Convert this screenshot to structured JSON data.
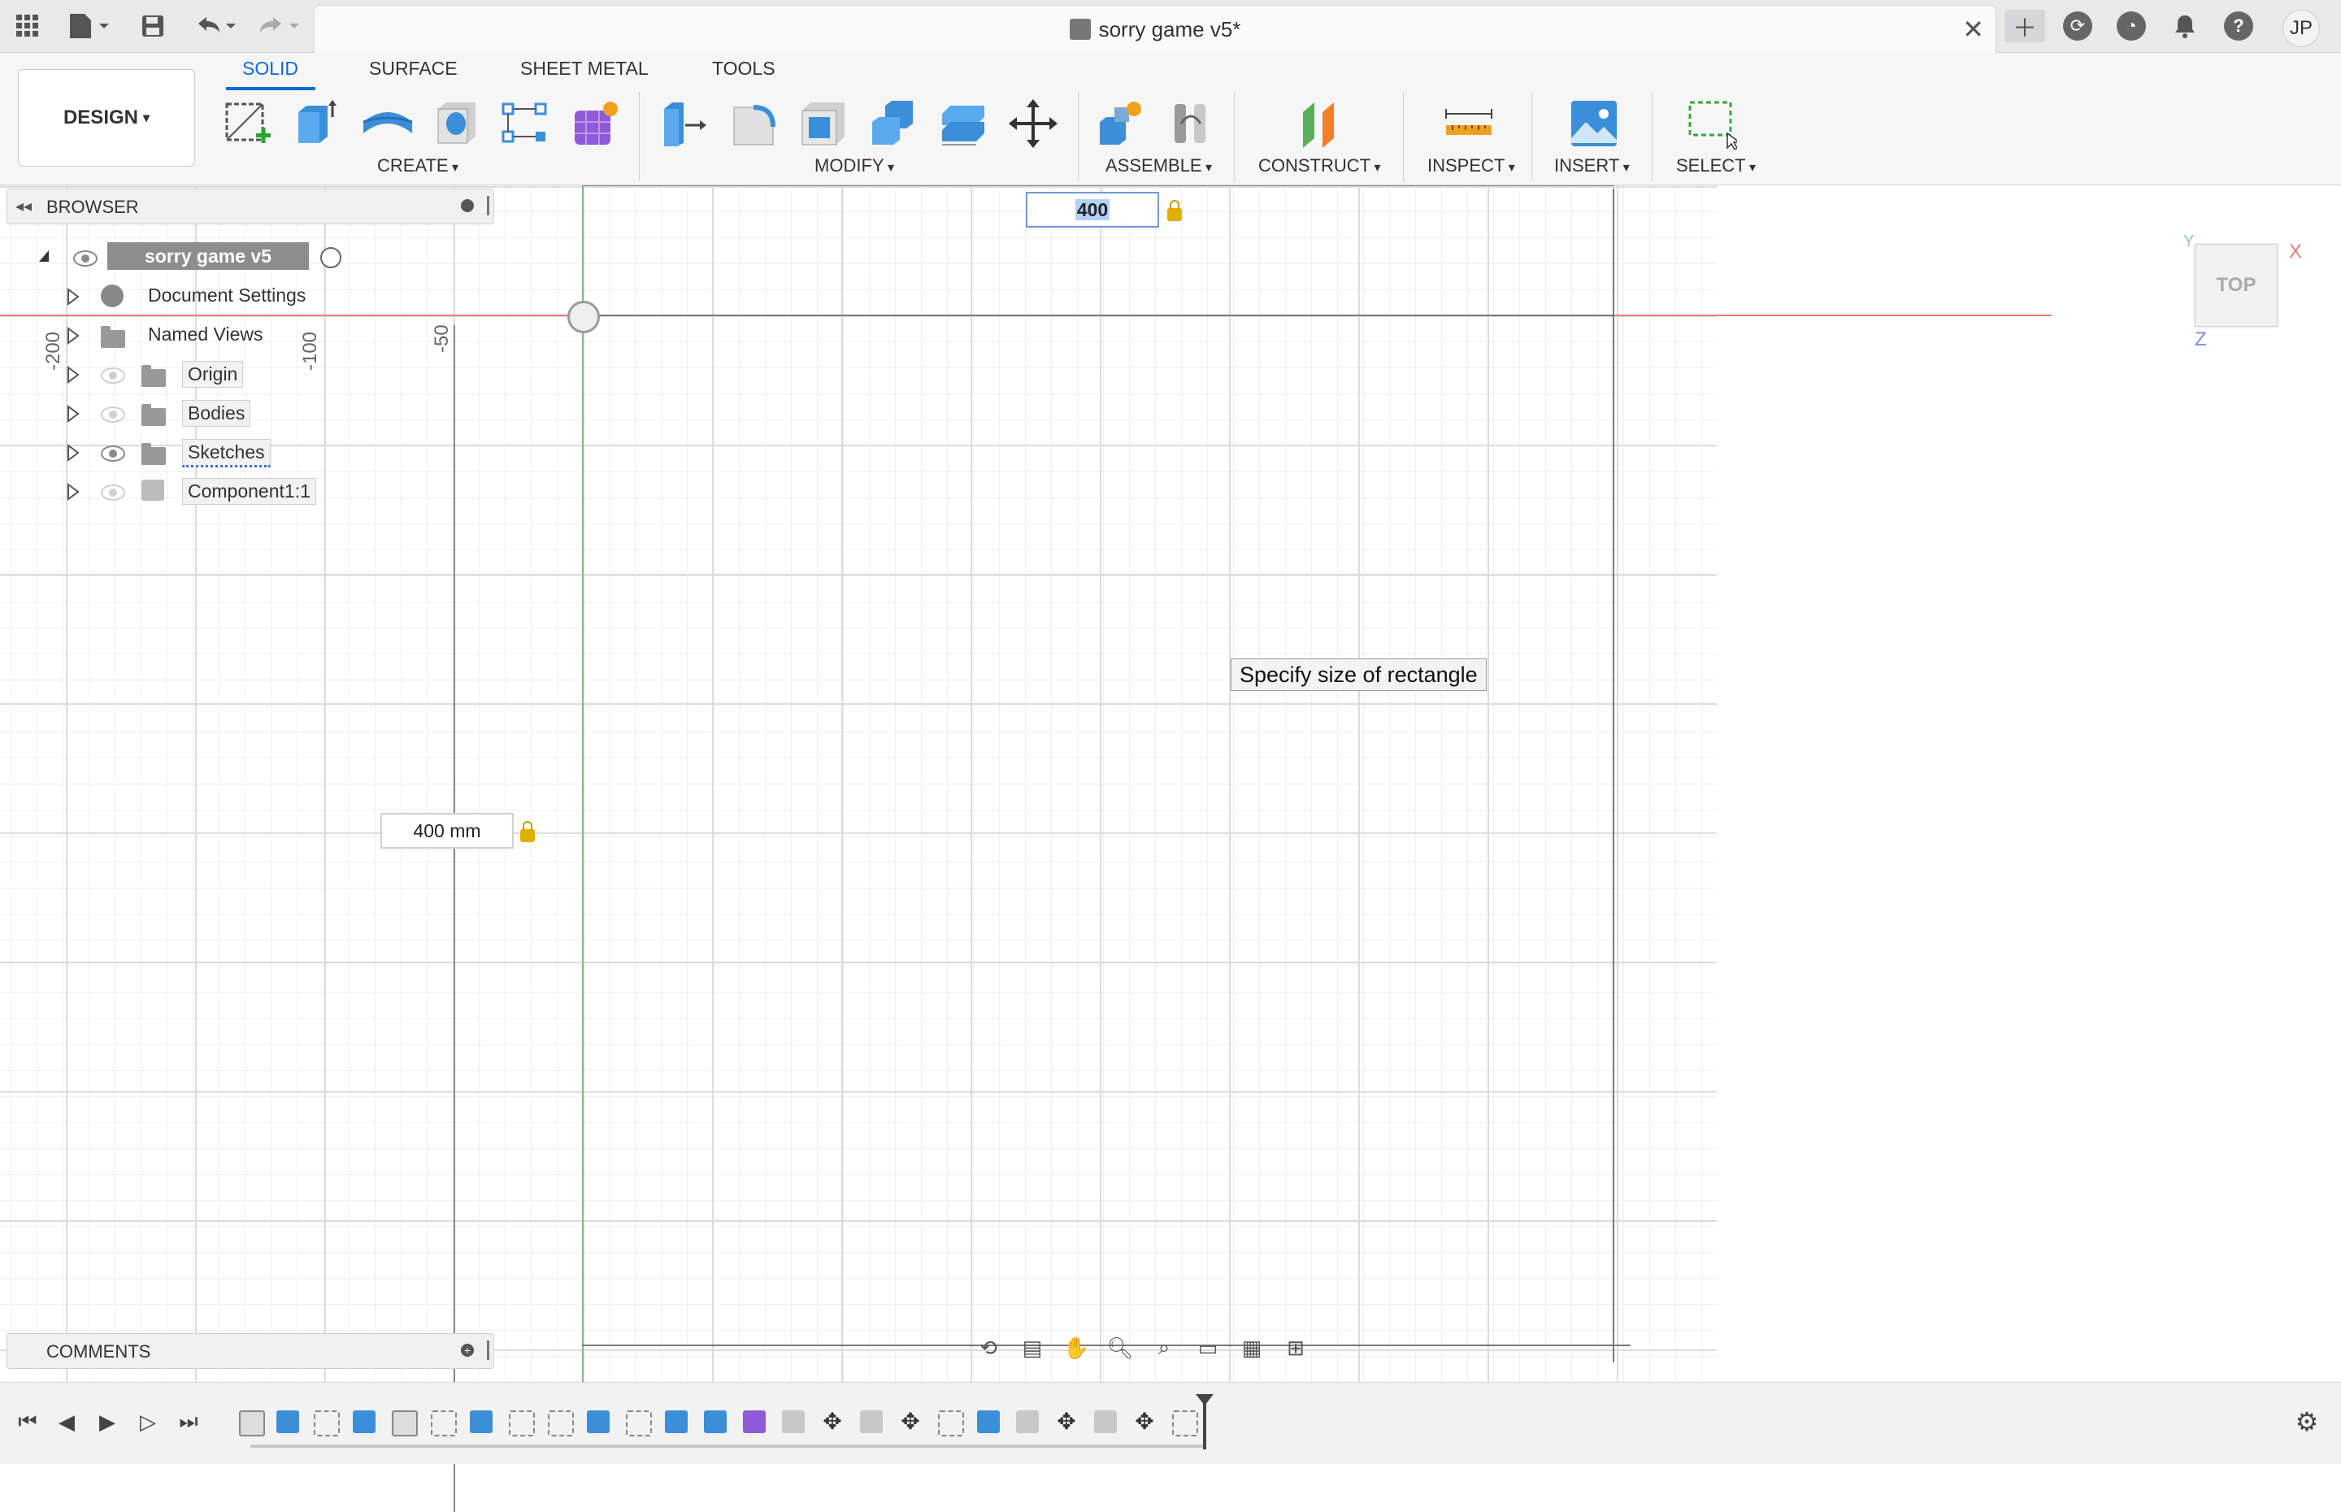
{
  "app": {
    "document_title": "sorry game v5*",
    "user_initials": "JP"
  },
  "toolbar": {
    "workspace_label": "DESIGN",
    "tabs": [
      "SOLID",
      "SURFACE",
      "SHEET METAL",
      "TOOLS"
    ],
    "active_tab": "SOLID",
    "groups": {
      "create": "CREATE",
      "modify": "MODIFY",
      "assemble": "ASSEMBLE",
      "construct": "CONSTRUCT",
      "inspect": "INSPECT",
      "insert": "INSERT",
      "select": "SELECT"
    }
  },
  "browser": {
    "title": "BROWSER",
    "root": "sorry game v5",
    "items": [
      {
        "label": "Document Settings"
      },
      {
        "label": "Named Views"
      },
      {
        "label": "Origin"
      },
      {
        "label": "Bodies"
      },
      {
        "label": "Sketches"
      },
      {
        "label": "Component1:1"
      }
    ]
  },
  "comments": {
    "title": "COMMENTS"
  },
  "canvas": {
    "ruler_labels": [
      "-200",
      "-100",
      "-50"
    ],
    "width_value": "400",
    "height_value": "400 mm",
    "tooltip": "Specify size of rectangle"
  },
  "viewcube": {
    "face": "TOP",
    "axes": {
      "x": "X",
      "y": "Y",
      "z": "Z"
    }
  },
  "colors": {
    "accent": "#0a6bd4",
    "x_axis": "#e97b7b",
    "y_axis": "#7ec37e"
  }
}
